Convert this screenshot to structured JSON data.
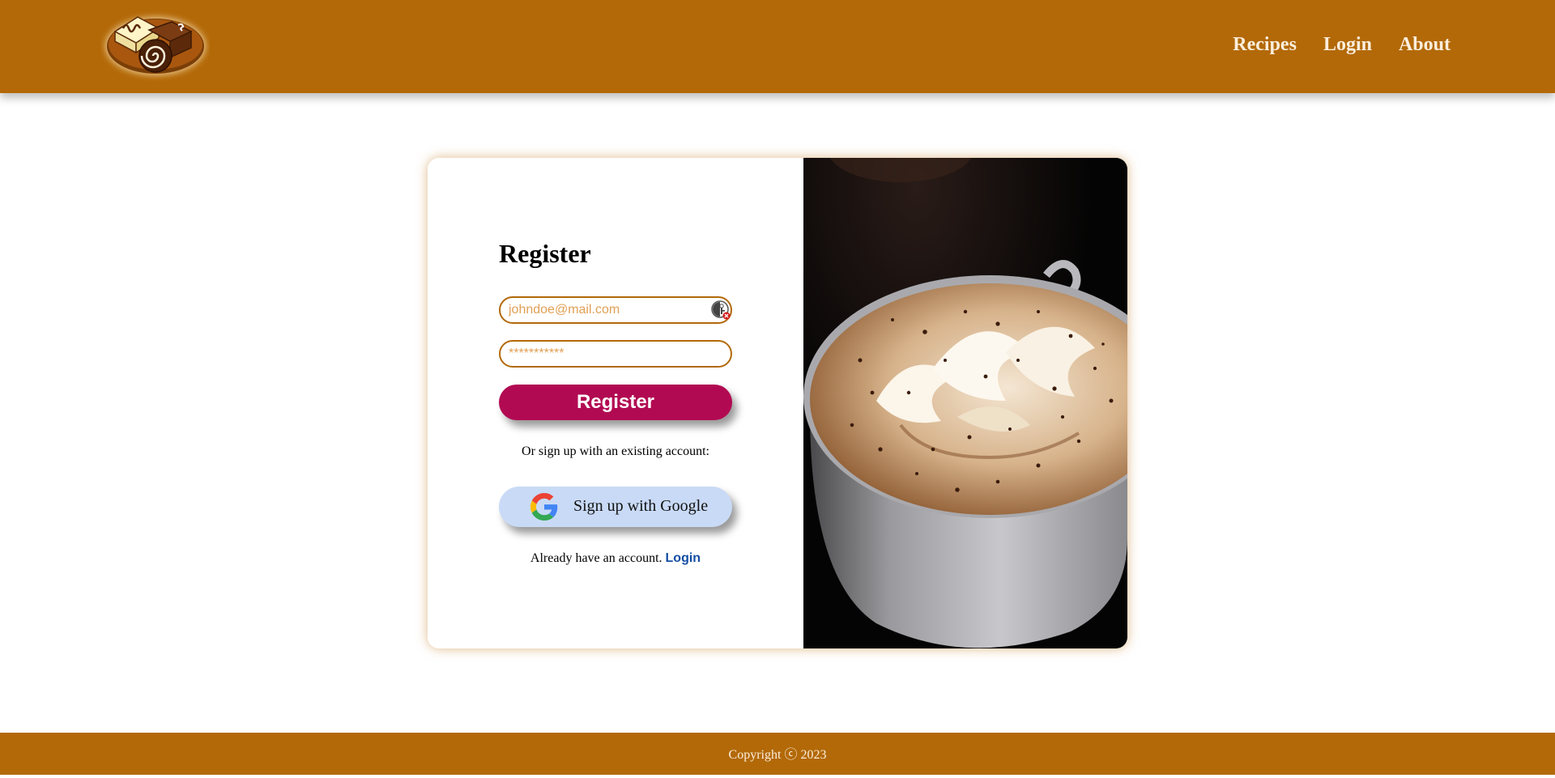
{
  "brand": {
    "logo_icon": "pastry-plate-logo"
  },
  "nav": {
    "links": [
      {
        "label": "Recipes"
      },
      {
        "label": "Login"
      },
      {
        "label": "About"
      }
    ]
  },
  "register_form": {
    "title": "Register",
    "email": {
      "placeholder": "johndoe@mail.com",
      "value": ""
    },
    "password": {
      "placeholder": "***********",
      "value": ""
    },
    "autofill_icon": "password-manager-key-icon",
    "submit_label": "Register",
    "alt_signup_text": "Or sign up with an existing account:",
    "google_button_label": "Sign up with Google",
    "have_account_text": "Already have an account.",
    "login_link_label": "Login"
  },
  "hero_image": {
    "subject": "cup-of-hot-chocolate-with-whipped-cream"
  },
  "footer": {
    "text": "Copyright ⓒ 2023"
  },
  "colors": {
    "header_bg": "#b36908",
    "register_button": "#b20a52",
    "google_button": "#c9daf6",
    "login_link": "#154ea3",
    "input_border": "#b36908"
  }
}
